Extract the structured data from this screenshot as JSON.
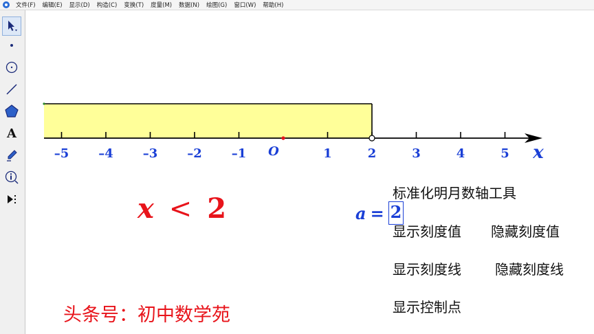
{
  "menu": [
    "文件(F)",
    "编辑(E)",
    "显示(D)",
    "构造(C)",
    "变换(T)",
    "度量(M)",
    "数据(N)",
    "绘图(G)",
    "窗口(W)",
    "帮助(H)"
  ],
  "toolbar": {
    "text_tool_glyph": "A"
  },
  "number_line": {
    "ticks": [
      "–5",
      "–4",
      "–3",
      "–2",
      "–1",
      "1",
      "2",
      "3",
      "4",
      "5"
    ],
    "tick_values": [
      -5,
      -4,
      -3,
      -2,
      -1,
      1,
      2,
      3,
      4,
      5
    ],
    "origin_label": "O",
    "axis_label": "x",
    "shaded_upper_bound": 2,
    "shade_color": "#ffff99",
    "label_color": "#1a3fd6",
    "origin_point_color": "#e8141b"
  },
  "inequality": {
    "variable": "x",
    "operator": "<",
    "value": "2"
  },
  "parameter": {
    "name": "a",
    "equals": "=",
    "value": "2"
  },
  "buttons": {
    "title": "标准化明月数轴工具",
    "show_tick_values": "显示刻度值",
    "hide_tick_values": "隐藏刻度值",
    "show_tick_marks": "显示刻度线",
    "hide_tick_marks": "隐藏刻度线",
    "show_control_points": "显示控制点"
  },
  "footer": "头条号：初中数学苑"
}
